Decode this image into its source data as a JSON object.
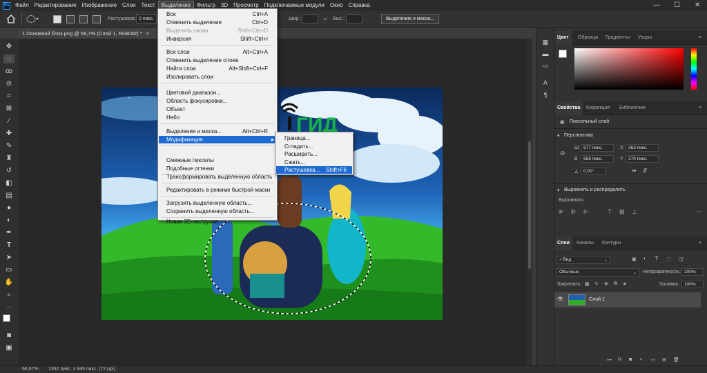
{
  "app": {
    "logo": "Ps",
    "minimize_label": "—",
    "maximize_label": "☐",
    "close_label": "✕"
  },
  "menubar": [
    "Файл",
    "Редактирование",
    "Изображение",
    "Слои",
    "Текст",
    "Выделение",
    "Фильтр",
    "3D",
    "Просмотр",
    "Подключаемые модули",
    "Окно",
    "Справка"
  ],
  "options": {
    "feather_label": "Растушевка:",
    "feather_value": "0 пикс.",
    "width_label": "Шир.:",
    "height_label": "Выс.:",
    "select_mask_button": "Выделение и маска..."
  },
  "document": {
    "tab": "1 Основной блок.png @ 66,7% (Слой 1, RGB/8#) *",
    "close_label": "×"
  },
  "status": {
    "zoom": "66,67%",
    "info": "1392 пикс. x 949 пикс. (72 ppi)"
  },
  "select_menu": {
    "items": [
      {
        "label": "Все",
        "shortcut": "Ctrl+A",
        "state": "normal"
      },
      {
        "label": "Отменить выделение",
        "shortcut": "Ctrl+D",
        "state": "normal"
      },
      {
        "label": "Выделить снова",
        "shortcut": "Shift+Ctrl+D",
        "state": "disabled"
      },
      {
        "label": "Инверсия",
        "shortcut": "Shift+Ctrl+I",
        "state": "normal"
      },
      {
        "label": "Все слои",
        "shortcut": "Alt+Ctrl+A",
        "state": "normal"
      },
      {
        "label": "Отменить выделение слоев",
        "shortcut": "",
        "state": "normal"
      },
      {
        "label": "Найти слои",
        "shortcut": "Alt+Shift+Ctrl+F",
        "state": "normal"
      },
      {
        "label": "Изолировать слои",
        "shortcut": "",
        "state": "normal"
      },
      {
        "label": "Цветовой диапазон...",
        "shortcut": "",
        "state": "normal"
      },
      {
        "label": "Область фокусировки...",
        "shortcut": "",
        "state": "normal"
      },
      {
        "label": "Объект",
        "shortcut": "",
        "state": "normal"
      },
      {
        "label": "Небо",
        "shortcut": "",
        "state": "normal"
      },
      {
        "label": "Выделение и маска...",
        "shortcut": "Alt+Ctrl+R",
        "state": "normal"
      },
      {
        "label": "Модификация",
        "shortcut": "",
        "state": "highlighted"
      },
      {
        "label": "Смежные пикселы",
        "shortcut": "",
        "state": "normal"
      },
      {
        "label": "Подобные оттенки",
        "shortcut": "",
        "state": "normal"
      },
      {
        "label": "Трансформировать выделенную область",
        "shortcut": "",
        "state": "normal"
      },
      {
        "label": "Редактировать в режиме быстрой маски",
        "shortcut": "",
        "state": "normal"
      },
      {
        "label": "Загрузить выделенную область...",
        "shortcut": "",
        "state": "normal"
      },
      {
        "label": "Сохранить выделенную область...",
        "shortcut": "",
        "state": "normal"
      },
      {
        "label": "Новая 3D-экструзия",
        "shortcut": "",
        "state": "normal"
      }
    ],
    "submenu_arrow": "▸"
  },
  "modify_submenu": {
    "items": [
      {
        "label": "Граница...",
        "shortcut": ""
      },
      {
        "label": "Сгладить...",
        "shortcut": ""
      },
      {
        "label": "Расширить...",
        "shortcut": ""
      },
      {
        "label": "Сжать...",
        "shortcut": ""
      },
      {
        "label": "Растушевка...",
        "shortcut": "Shift+F6"
      }
    ]
  },
  "color_panel": {
    "tabs": [
      "Цвет",
      "Образцы",
      "Градиенты",
      "Узоры"
    ]
  },
  "properties_panel": {
    "tabs": [
      "Свойства",
      "Коррекция",
      "Библиотеки"
    ],
    "layer_type": "Пиксельный слой",
    "transform_section": "Перспектива",
    "w_label": "Ш",
    "w_value": "677 пикс.",
    "x_label": "X",
    "x_value": "363 пикс.",
    "h_label": "В",
    "h_value": "656 пикс.",
    "y_label": "Y",
    "y_value": "270 пикс.",
    "angle_value": "0,00°",
    "align_section": "Выровнять и распределить",
    "align_label": "Выровнять:"
  },
  "layers_panel": {
    "tabs": [
      "Слои",
      "Каналы",
      "Контуры"
    ],
    "filter_value": "Вид",
    "blend_mode": "Обычные",
    "opacity_label": "Непрозрачность:",
    "opacity_value": "100%",
    "lock_label": "Закрепить:",
    "fill_label": "Заливка:",
    "fill_value": "100%",
    "layers": [
      {
        "name": "Слой 1",
        "visible": true
      }
    ]
  },
  "canvas_text": "ГИД",
  "icons": {
    "visibility": "👁"
  }
}
